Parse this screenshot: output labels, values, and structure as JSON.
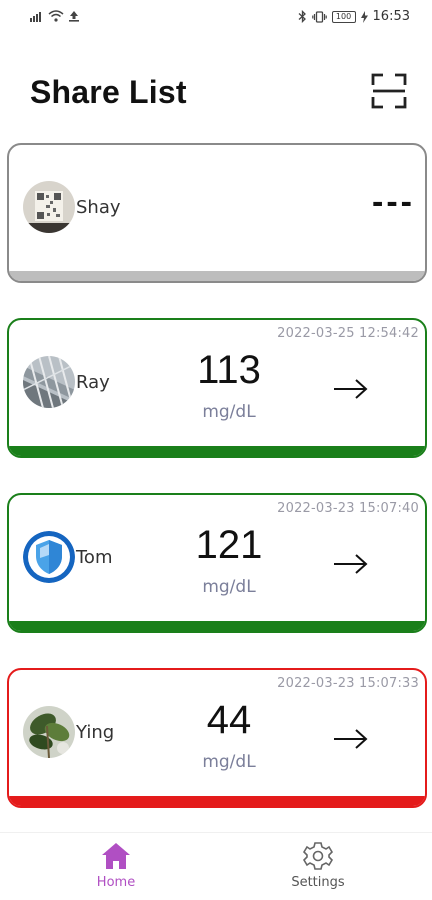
{
  "status_bar": {
    "time": "16:53",
    "battery": "100"
  },
  "header": {
    "title": "Share List"
  },
  "colors": {
    "normal": "#1a7f1a",
    "alert": "#e41b1b",
    "inactive": "#8a8a8a",
    "inactive_bar": "#bdbdbd",
    "nav_active": "#b04fc3",
    "nav_inactive": "#555555"
  },
  "cards": [
    {
      "name": "Shay",
      "reading": "---",
      "status": "inactive",
      "icon": "qr-code-avatar"
    },
    {
      "name": "Ray",
      "timestamp": "2022-03-25 12:54:42",
      "value": "113",
      "unit": "mg/dL",
      "status": "normal",
      "icon": "building-avatar"
    },
    {
      "name": "Tom",
      "timestamp": "2022-03-23 15:07:40",
      "value": "121",
      "unit": "mg/dL",
      "status": "normal",
      "icon": "shield-avatar"
    },
    {
      "name": "Ying",
      "timestamp": "2022-03-23 15:07:33",
      "value": "44",
      "unit": "mg/dL",
      "status": "alert",
      "icon": "plant-avatar"
    }
  ],
  "nav": {
    "home_label": "Home",
    "settings_label": "Settings",
    "active": "home"
  }
}
